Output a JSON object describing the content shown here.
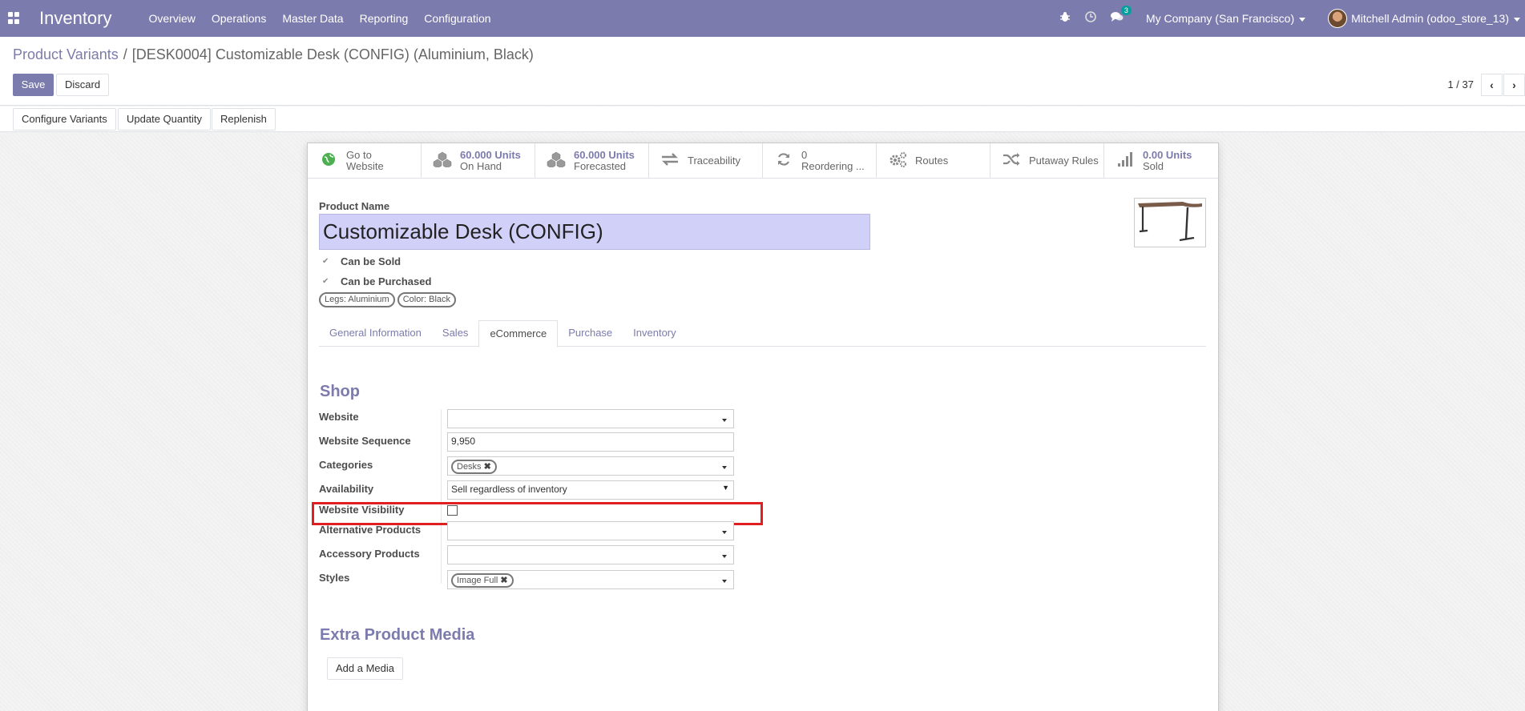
{
  "navbar": {
    "app_name": "Inventory",
    "menu": [
      "Overview",
      "Operations",
      "Master Data",
      "Reporting",
      "Configuration"
    ],
    "messages_count": "3",
    "company": "My Company (San Francisco)",
    "user": "Mitchell Admin (odoo_store_13)",
    "bg_color": "#7c7bad"
  },
  "breadcrumb": {
    "parent": "Product Variants",
    "separator": "/",
    "current": "[DESK0004] Customizable Desk (CONFIG) (Aluminium, Black)"
  },
  "buttons": {
    "save": "Save",
    "discard": "Discard",
    "configure_variants": "Configure Variants",
    "update_quantity": "Update Quantity",
    "replenish": "Replenish",
    "add_media": "Add a Media"
  },
  "pager": {
    "value": "1 / 37",
    "prev_icon": "chevron-left-icon",
    "next_icon": "chevron-right-icon"
  },
  "smart_buttons": [
    {
      "icon": "globe-icon",
      "value": "",
      "label_1": "Go to",
      "label_2": "Website"
    },
    {
      "icon": "cubes-icon",
      "value": "60.000 Units",
      "label_2": "On Hand"
    },
    {
      "icon": "cubes-icon",
      "value": "60.000 Units",
      "label_2": "Forecasted"
    },
    {
      "icon": "exchange-icon",
      "value": "",
      "label_1": "Traceability",
      "label_2": ""
    },
    {
      "icon": "refresh-icon",
      "value": "",
      "label_1": "0",
      "label_2": "Reordering ..."
    },
    {
      "icon": "cogs-icon",
      "value": "",
      "label_1": "Routes",
      "label_2": ""
    },
    {
      "icon": "random-icon",
      "value": "",
      "label_1": "Putaway Rules",
      "label_2": ""
    },
    {
      "icon": "signal-icon",
      "value": "0.00 Units",
      "label_2": "Sold"
    }
  ],
  "form": {
    "product_name_label": "Product Name",
    "product_name": "Customizable Desk (CONFIG)",
    "can_be_sold": "Can be Sold",
    "can_be_purchased": "Can be Purchased",
    "attribute_tags": [
      "Legs: Aluminium",
      "Color: Black"
    ]
  },
  "tabs": [
    {
      "label": "General Information",
      "active": false
    },
    {
      "label": "Sales",
      "active": false
    },
    {
      "label": "eCommerce",
      "active": true
    },
    {
      "label": "Purchase",
      "active": false
    },
    {
      "label": "Inventory",
      "active": false
    }
  ],
  "shop": {
    "title": "Shop",
    "website_label": "Website",
    "website_value": "",
    "sequence_label": "Website Sequence",
    "sequence_value": "9,950",
    "categories_label": "Categories",
    "categories_tag": "Desks",
    "availability_label": "Availability",
    "availability_value": "Sell regardless of inventory",
    "visibility_label": "Website Visibility",
    "visibility_checked": false,
    "alternative_label": "Alternative Products",
    "accessory_label": "Accessory Products",
    "styles_label": "Styles",
    "styles_tag": "Image Full"
  },
  "media": {
    "title": "Extra Product Media"
  }
}
